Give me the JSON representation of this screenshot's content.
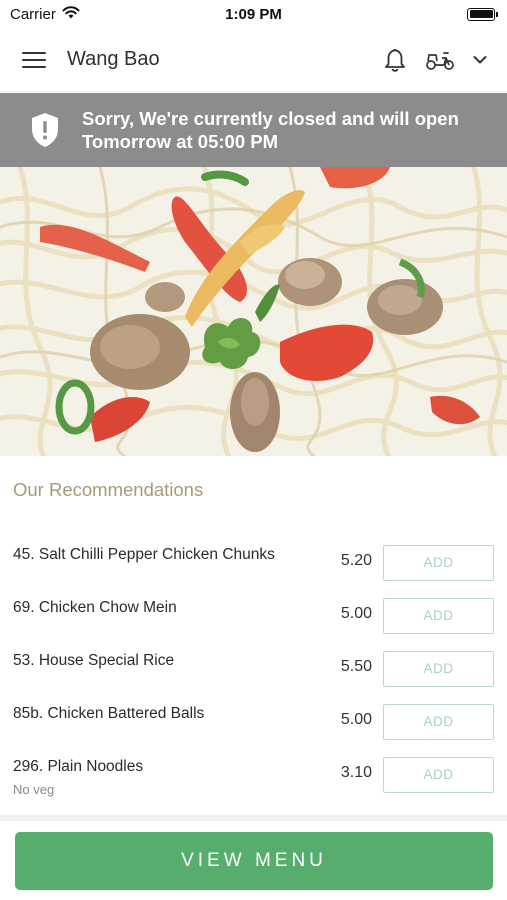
{
  "status": {
    "carrier": "Carrier",
    "time": "1:09 PM"
  },
  "nav": {
    "title": "Wang Bao"
  },
  "banner": {
    "line1": "Sorry, We're currently closed and will open",
    "line2": "Tomorrow at 05:00 PM"
  },
  "recommendations": {
    "title": "Our Recommendations",
    "add_label": "ADD",
    "items": [
      {
        "name": "45. Salt Chilli Pepper Chicken Chunks",
        "price": "5.20",
        "note": ""
      },
      {
        "name": "69. Chicken Chow Mein",
        "price": "5.00",
        "note": ""
      },
      {
        "name": "53. House Special Rice",
        "price": "5.50",
        "note": ""
      },
      {
        "name": "85b. Chicken Battered Balls",
        "price": "5.00",
        "note": ""
      },
      {
        "name": "296. Plain Noodles",
        "price": "3.10",
        "note": "No veg"
      }
    ]
  },
  "footer": {
    "view_menu_label": "VIEW MENU"
  },
  "colors": {
    "accent_green": "#57ad6e",
    "banner_grey": "#8c8c8c",
    "section_title": "#a8997a"
  },
  "icons": [
    "wifi-icon",
    "battery-icon",
    "hamburger-menu-icon",
    "bell-icon",
    "scooter-icon",
    "chevron-down-icon",
    "shield-alert-icon"
  ]
}
